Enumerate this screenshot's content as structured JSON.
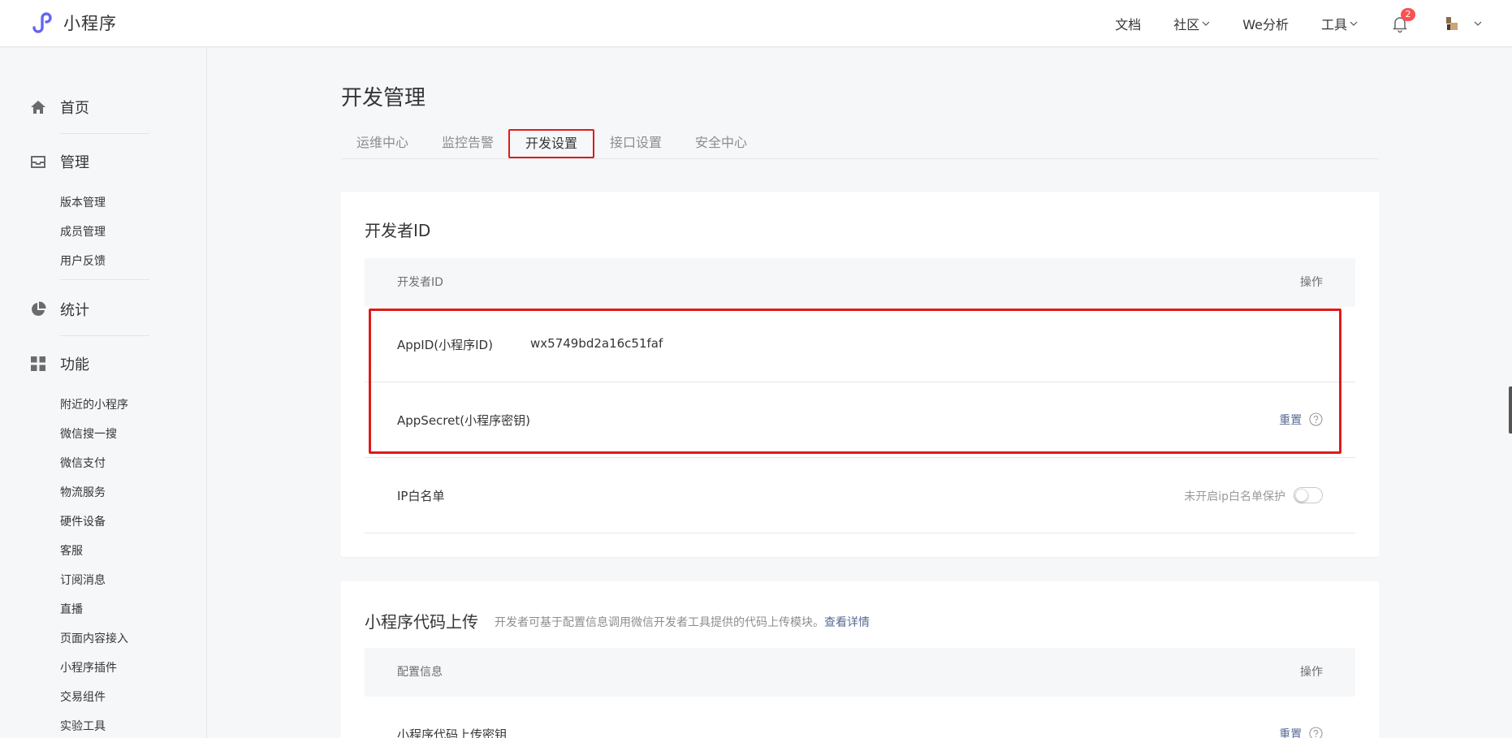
{
  "header": {
    "logo_text": "小程序",
    "nav": [
      {
        "label": "文档"
      },
      {
        "label": "社区"
      },
      {
        "label": "We分析"
      },
      {
        "label": "工具"
      }
    ],
    "notification_count": "2"
  },
  "sidebar": {
    "home": "首页",
    "manage": "管理",
    "manage_items": [
      "版本管理",
      "成员管理",
      "用户反馈"
    ],
    "stats": "统计",
    "features": "功能",
    "feature_items": [
      "附近的小程序",
      "微信搜一搜",
      "微信支付",
      "物流服务",
      "硬件设备",
      "客服",
      "订阅消息",
      "直播",
      "页面内容接入",
      "小程序插件",
      "交易组件",
      "实验工具"
    ]
  },
  "page": {
    "title": "开发管理",
    "tabs": [
      "运维中心",
      "监控告警",
      "开发设置",
      "接口设置",
      "安全中心"
    ],
    "active_tab": "开发设置"
  },
  "dev_id_card": {
    "title": "开发者ID",
    "col_name": "开发者ID",
    "col_action": "操作",
    "appid_label": "AppID(小程序ID)",
    "appid_value": "wx5749bd2a16c51faf",
    "secret_label": "AppSecret(小程序密钥)",
    "secret_action": "重置",
    "ip_label": "IP白名单",
    "ip_status": "未开启ip白名单保护",
    "ip_enabled": false
  },
  "upload_card": {
    "title": "小程序代码上传",
    "desc": "开发者可基于配置信息调用微信开发者工具提供的代码上传模块。",
    "desc_link": "查看详情",
    "col_name": "配置信息",
    "col_action": "操作",
    "row_label": "小程序代码上传密钥",
    "row_action": "重置"
  },
  "colors": {
    "accent_link": "#576b95",
    "highlight": "#e01a1a",
    "badge": "#fa5151",
    "logo": "#6467f0"
  }
}
